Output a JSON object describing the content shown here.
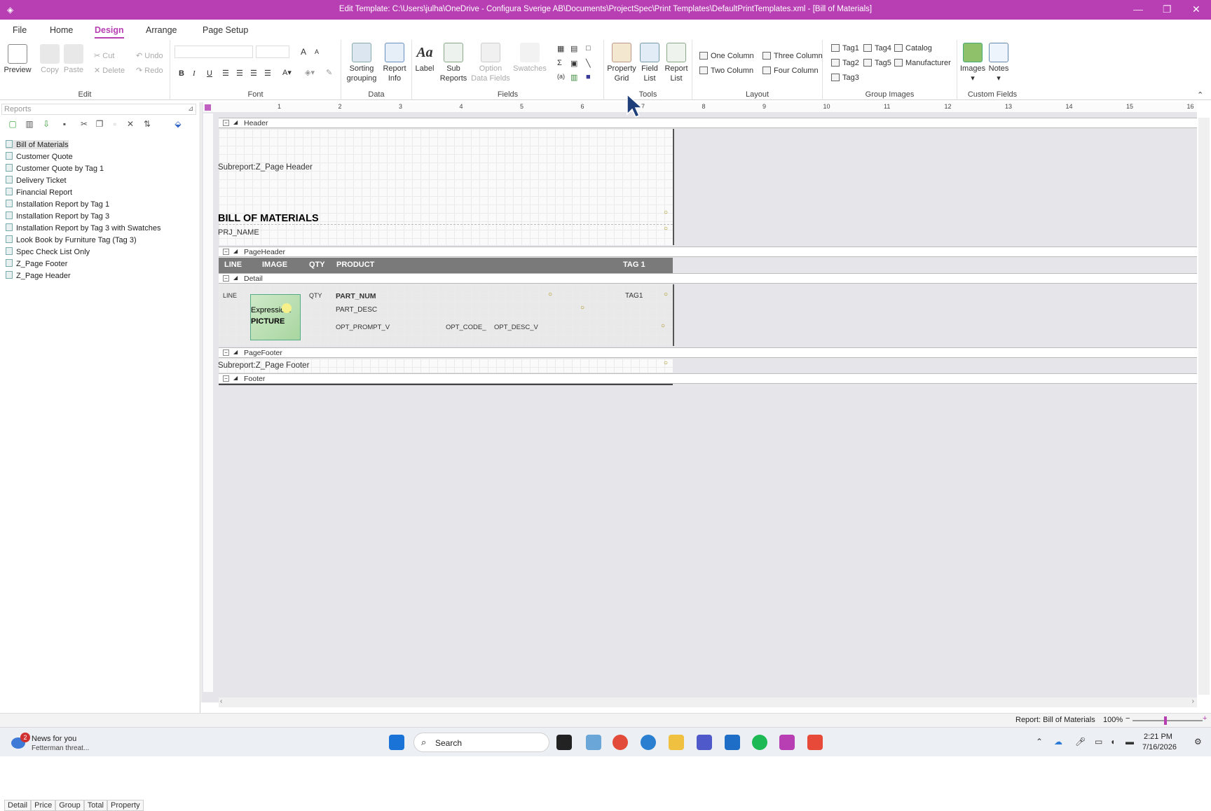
{
  "window": {
    "title": "Edit Template:  C:\\Users\\julha\\OneDrive - Configura Sverige AB\\Documents\\ProjectSpec\\Print Templates\\DefaultPrintTemplates.xml - [Bill of Materials]"
  },
  "menu": {
    "tabs": [
      "File",
      "Home",
      "Design",
      "Arrange",
      "Page Setup"
    ],
    "active": "Design"
  },
  "ribbon": {
    "preview": "Preview",
    "edit": {
      "copy": "Copy",
      "paste": "Paste",
      "cut": "Cut",
      "delete": "Delete",
      "undo": "Undo",
      "redo": "Redo",
      "label": "Edit"
    },
    "font": {
      "label": "Font",
      "bold": "B",
      "italic": "I",
      "underline": "U",
      "grow": "A",
      "shrink": "A"
    },
    "data": {
      "sorting": "Sorting",
      "grouping": "grouping",
      "report": "Report",
      "info": "Info",
      "label": "Data"
    },
    "fields": {
      "label_btn": "Label",
      "sub": "Sub",
      "reports": "Reports",
      "option": "Option",
      "datafields": "Data Fields",
      "swatches": "Swatches",
      "label": "Fields"
    },
    "tools": {
      "property": "Property",
      "grid": "Grid",
      "field": "Field",
      "list": "List",
      "report": "Report",
      "rlist": "List",
      "label": "Tools"
    },
    "layout": {
      "one": "One Column",
      "two": "Two Column",
      "three": "Three Column",
      "four": "Four Column",
      "label": "Layout"
    },
    "groupimages": {
      "tag1": "Tag1",
      "tag2": "Tag2",
      "tag3": "Tag3",
      "tag4": "Tag4",
      "tag5": "Tag5",
      "catalog": "Catalog",
      "manufacturer": "Manufacturer",
      "label": "Group Images"
    },
    "custom": {
      "images": "Images",
      "notes": "Notes",
      "label": "Custom Fields"
    }
  },
  "reports": {
    "label": "Reports",
    "items": [
      "Bill of Materials",
      "Customer Quote",
      "Customer Quote by Tag 1",
      "Delivery Ticket",
      "Financial Report",
      "Installation Report by Tag 1",
      "Installation Report by Tag 3",
      "Installation Report by Tag 3 with Swatches",
      "Look Book by Furniture Tag (Tag 3)",
      "Spec Check List Only",
      "Z_Page Footer",
      "Z_Page Header"
    ],
    "selected": "Bill of Materials",
    "bottom_tabs": [
      "Detail",
      "Price",
      "Group",
      "Total",
      "Property"
    ]
  },
  "ruler": {
    "ticks": [
      "1",
      "2",
      "3",
      "4",
      "5",
      "6",
      "7",
      "8",
      "9",
      "10",
      "11",
      "12",
      "13",
      "14",
      "15",
      "16"
    ]
  },
  "design": {
    "bands": {
      "header": "Header",
      "pageheader": "PageHeader",
      "detail": "Detail",
      "pagefooter": "PageFooter",
      "footer": "Footer"
    },
    "subreport_header": "Subreport:Z_Page Header",
    "title": "BILL OF MATERIALS",
    "prj": "PRJ_NAME",
    "columns": [
      "LINE",
      "IMAGE",
      "QTY",
      "PRODUCT",
      "TAG 1"
    ],
    "detail": {
      "line": "LINE",
      "expression": "Expression:",
      "picture": "PICTURE",
      "qty": "QTY",
      "part_num": "PART_NUM",
      "part_desc": "PART_DESC",
      "opt_prompt": "OPT_PROMPT_V",
      "opt_code": "OPT_CODE_",
      "opt_desc": "OPT_DESC_V",
      "tag1": "TAG1"
    },
    "subreport_footer": "Subreport:Z_Page Footer"
  },
  "status": {
    "report": "Report: Bill of Materials",
    "zoom": "100%"
  },
  "taskbar": {
    "news_title": "News for you",
    "news_sub": "Fetterman threat...",
    "news_badge": "2",
    "search": "Search",
    "time": "2:21 PM",
    "date": "7/16/2026"
  }
}
